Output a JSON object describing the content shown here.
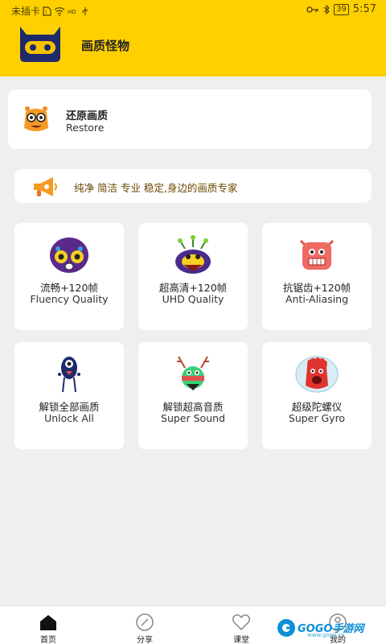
{
  "status_bar": {
    "left_text": "未插卡",
    "icons": [
      "sim-icon",
      "wifi-icon",
      "hd-icon",
      "usb-icon"
    ],
    "right_icons": [
      "key-icon",
      "bluetooth-icon"
    ],
    "battery": "39",
    "time": "5:57"
  },
  "header": {
    "title": "画质怪物",
    "bg_color": "#ffd000"
  },
  "restore": {
    "title": "还原画质",
    "subtitle": "Restore"
  },
  "slogan": {
    "text": "纯净 简洁 专业 稳定,身边的画质专家"
  },
  "tiles": [
    {
      "zh": "流畅+120帧",
      "en": "Fluency Quality",
      "icon": "purple-monster-icon"
    },
    {
      "zh": "超高清+120帧",
      "en": "UHD Quality",
      "icon": "antenna-monster-icon"
    },
    {
      "zh": "抗锯齿+120帧",
      "en": "Anti-Aliasing",
      "icon": "pink-monster-icon"
    },
    {
      "zh": "解锁全部画质",
      "en": "Unlock All",
      "icon": "one-eye-monster-icon"
    },
    {
      "zh": "解锁超高音质",
      "en": "Super Sound",
      "icon": "antler-monster-icon"
    },
    {
      "zh": "超级陀螺仪",
      "en": "Super Gyro",
      "icon": "red-hand-monster-icon"
    }
  ],
  "bottom_nav": [
    {
      "label": "首页",
      "icon": "home-icon"
    },
    {
      "label": "分享",
      "icon": "compass-icon"
    },
    {
      "label": "课堂",
      "icon": "heart-icon"
    },
    {
      "label": "我的",
      "icon": "profile-icon"
    }
  ],
  "watermark": {
    "text": "GOGO手游网",
    "sub": "www.gogo.cn"
  }
}
